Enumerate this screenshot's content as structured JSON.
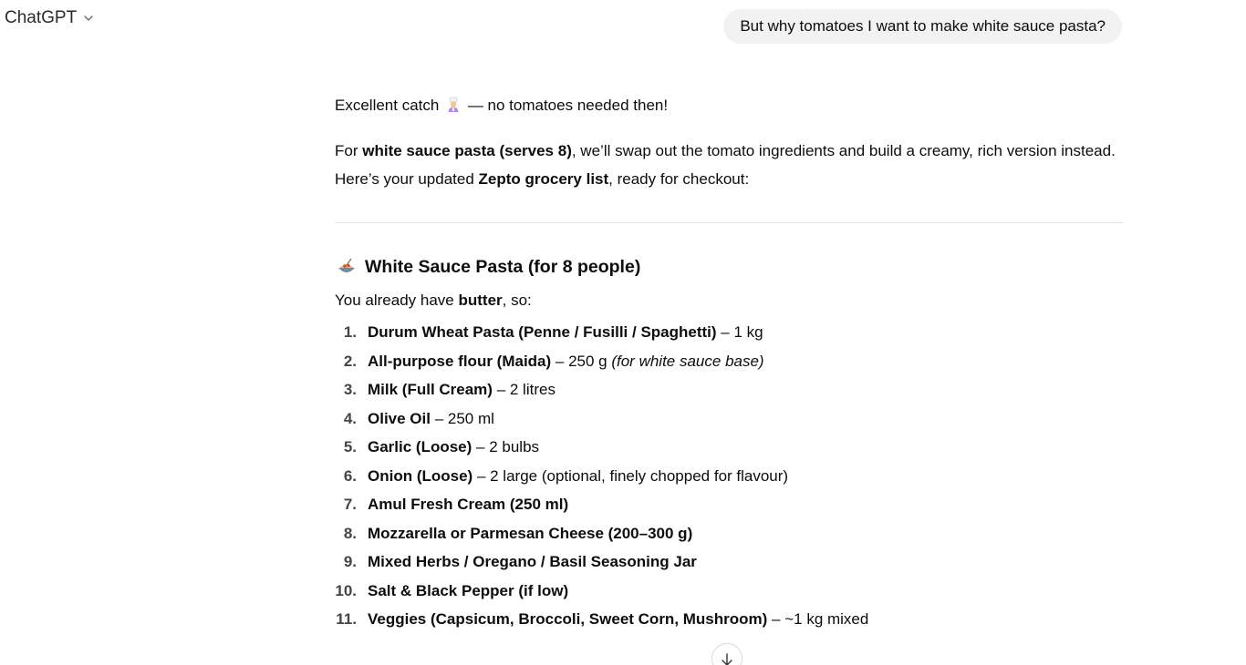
{
  "header": {
    "model_name": "ChatGPT",
    "dropdown_icon": "chevron-down-icon"
  },
  "user_message": "But why tomatoes I want to make white sauce pasta?",
  "assistant": {
    "line1_before": "Excellent catch",
    "line1_emoji": "cook-emoji",
    "line1_after": "— no tomatoes needed then!",
    "p2_a": "For ",
    "p2_b": "white sauce pasta (serves 8)",
    "p2_c": ", we’ll swap out the tomato ingredients and build a creamy, rich version instead. Here’s your updated ",
    "p2_d": "Zepto grocery list",
    "p2_e": ", ready for checkout:",
    "heading_emoji": "spaghetti-emoji",
    "heading": "White Sauce Pasta (for 8 people)",
    "intro_a": "You already have ",
    "intro_b": "butter",
    "intro_c": ", so:",
    "items": [
      {
        "num": "1.",
        "name": "Durum Wheat Pasta (Penne / Fusilli / Spaghetti)",
        "detail": " – 1 kg",
        "note": ""
      },
      {
        "num": "2.",
        "name": "All-purpose flour (Maida)",
        "detail": " – 250 g ",
        "note": "(for white sauce base)"
      },
      {
        "num": "3.",
        "name": "Milk (Full Cream)",
        "detail": " – 2 litres",
        "note": ""
      },
      {
        "num": "4.",
        "name": "Olive Oil",
        "detail": " – 250 ml",
        "note": ""
      },
      {
        "num": "5.",
        "name": "Garlic (Loose)",
        "detail": " – 2 bulbs",
        "note": ""
      },
      {
        "num": "6.",
        "name": "Onion (Loose)",
        "detail": " – 2 large (optional, finely chopped for flavour)",
        "note": ""
      },
      {
        "num": "7.",
        "name": "Amul Fresh Cream (250 ml)",
        "detail": "",
        "note": ""
      },
      {
        "num": "8.",
        "name": "Mozzarella or Parmesan Cheese (200–300 g)",
        "detail": "",
        "note": ""
      },
      {
        "num": "9.",
        "name": "Mixed Herbs / Oregano / Basil Seasoning Jar",
        "detail": "",
        "note": ""
      },
      {
        "num": "10.",
        "name": "Salt & Black Pepper (if low)",
        "detail": "",
        "note": ""
      },
      {
        "num": "11.",
        "name": "Veggies (Capsicum, Broccoli, Sweet Corn, Mushroom)",
        "detail": " – ~1 kg mixed",
        "note": ""
      }
    ]
  },
  "scroll_button_icon": "arrow-down-icon"
}
